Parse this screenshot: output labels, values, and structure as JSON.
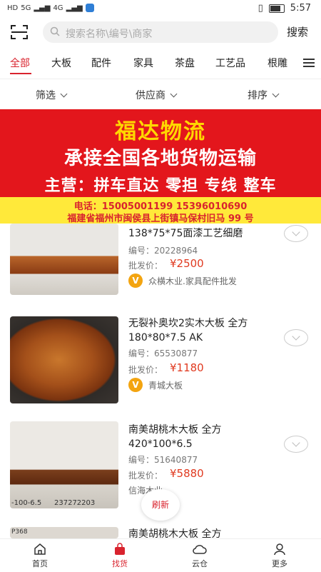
{
  "status_bar": {
    "left": [
      "HD",
      "5G",
      "4G"
    ],
    "time": "5:57"
  },
  "search": {
    "placeholder": "搜索名称\\编号\\商家",
    "button": "搜索"
  },
  "categories": [
    "全部",
    "大板",
    "配件",
    "家具",
    "茶盘",
    "工艺品",
    "根雕"
  ],
  "filters": [
    "筛选",
    "供应商",
    "排序"
  ],
  "banner": {
    "line1": "福达物流",
    "line2": "承接全国各地货物运输",
    "line3": "主营：拼车直达  零担  专线  整车",
    "phone": "电话：15005001199  15396010690",
    "address": "福建省福州市闽侯县上街镇马保村旧马 99 号"
  },
  "products": [
    {
      "title": "138*75*75面漆工艺细磨",
      "code_label": "编号：",
      "code": "20228964",
      "price_label": "批发价：",
      "price": "¥2500",
      "seller": "众横木业.家具配件批发",
      "verified": true
    },
    {
      "title": "无裂补奥坎2实木大板 全方 180*80*7.5 AK",
      "code_label": "编号：",
      "code": "65530877",
      "price_label": "批发价：",
      "price": "¥1180",
      "seller": "青城大板",
      "verified": true
    },
    {
      "title": "南美胡桃木大板 全方 420*100*6.5",
      "code_label": "编号：",
      "code": "51640877",
      "price_label": "批发价：",
      "price": "¥5880",
      "seller": "信海木业",
      "image_caption_left": "-100-6.5",
      "image_caption_right": "237272203",
      "verified": false
    },
    {
      "title": "南美胡桃木大板 全方",
      "image_caption_left": "P368"
    }
  ],
  "refresh_label": "刷新",
  "tabs": [
    {
      "label": "首页",
      "icon": "home-icon"
    },
    {
      "label": "找货",
      "icon": "bag-icon"
    },
    {
      "label": "云仓",
      "icon": "cloud-icon"
    },
    {
      "label": "更多",
      "icon": "user-icon"
    }
  ],
  "colors": {
    "accent": "#d9232e",
    "banner_red": "#e3161c",
    "banner_yellow": "#ffe93a",
    "price": "#e03a20"
  }
}
